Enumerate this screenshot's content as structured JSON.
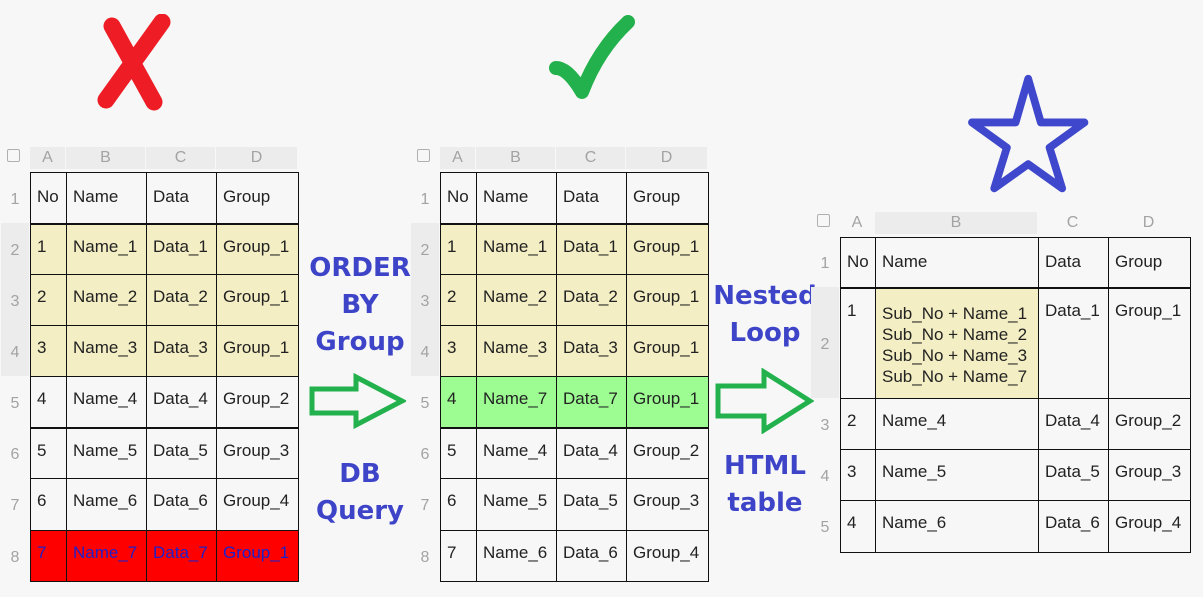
{
  "symbols": {
    "wrong": "cross-mark",
    "right": "check-mark",
    "best": "star-outline",
    "colors": {
      "cross": "#ee1c25",
      "check": "#22b14c",
      "star": "#3f48cc",
      "arrow": "#22b14c",
      "label": "#3f48cc"
    }
  },
  "column_letters": [
    "A",
    "B",
    "C",
    "D"
  ],
  "tables": {
    "wrong": {
      "row_numbers": [
        "1",
        "2",
        "3",
        "4",
        "5",
        "6",
        "7",
        "8"
      ],
      "header": [
        "No",
        "Name",
        "Data",
        "Group"
      ],
      "rows": [
        {
          "cells": [
            "1",
            "Name_1",
            "Data_1",
            "Group_1"
          ],
          "highlight": "yellow"
        },
        {
          "cells": [
            "2",
            "Name_2",
            "Data_2",
            "Group_1"
          ],
          "highlight": "yellow"
        },
        {
          "cells": [
            "3",
            "Name_3",
            "Data_3",
            "Group_1"
          ],
          "highlight": "yellow"
        },
        {
          "cells": [
            "4",
            "Name_4",
            "Data_4",
            "Group_2"
          ],
          "highlight": "none"
        },
        {
          "cells": [
            "5",
            "Name_5",
            "Data_5",
            "Group_3"
          ],
          "highlight": "none"
        },
        {
          "cells": [
            "6",
            "Name_6",
            "Data_6",
            "Group_4"
          ],
          "highlight": "none"
        },
        {
          "cells": [
            "7",
            "Name_7",
            "Data_7",
            "Group_1"
          ],
          "highlight": "red"
        }
      ]
    },
    "sorted": {
      "row_numbers": [
        "1",
        "2",
        "3",
        "4",
        "5",
        "6",
        "7",
        "8"
      ],
      "header": [
        "No",
        "Name",
        "Data",
        "Group"
      ],
      "rows": [
        {
          "cells": [
            "1",
            "Name_1",
            "Data_1",
            "Group_1"
          ],
          "highlight": "yellow"
        },
        {
          "cells": [
            "2",
            "Name_2",
            "Data_2",
            "Group_1"
          ],
          "highlight": "yellow"
        },
        {
          "cells": [
            "3",
            "Name_3",
            "Data_3",
            "Group_1"
          ],
          "highlight": "yellow"
        },
        {
          "cells": [
            "4",
            "Name_7",
            "Data_7",
            "Group_1"
          ],
          "highlight": "green"
        },
        {
          "cells": [
            "5",
            "Name_4",
            "Data_4",
            "Group_2"
          ],
          "highlight": "none"
        },
        {
          "cells": [
            "6",
            "Name_5",
            "Data_5",
            "Group_3"
          ],
          "highlight": "none"
        },
        {
          "cells": [
            "7",
            "Name_6",
            "Data_6",
            "Group_4"
          ],
          "highlight": "none"
        }
      ]
    },
    "nested": {
      "row_numbers": [
        "1",
        "2",
        "3",
        "4",
        "5"
      ],
      "header": [
        "No",
        "Name",
        "Data",
        "Group"
      ],
      "rows": [
        {
          "cells": [
            "1",
            [
              "Sub_No + Name_1",
              "Sub_No + Name_2",
              "Sub_No + Name_3",
              "Sub_No + Name_7"
            ],
            "Data_1",
            "Group_1"
          ],
          "highlight": "yellow-name"
        },
        {
          "cells": [
            "2",
            "Name_4",
            "Data_4",
            "Group_2"
          ],
          "highlight": "none"
        },
        {
          "cells": [
            "3",
            "Name_5",
            "Data_5",
            "Group_3"
          ],
          "highlight": "none"
        },
        {
          "cells": [
            "4",
            "Name_6",
            "Data_6",
            "Group_4"
          ],
          "highlight": "none"
        }
      ]
    }
  },
  "steps": {
    "step1": {
      "top": [
        "ORDER",
        "BY",
        "Group"
      ],
      "bottom": [
        "DB",
        "Query"
      ]
    },
    "step2": {
      "top": [
        "Nested",
        "Loop"
      ],
      "bottom": [
        "HTML",
        "table"
      ]
    }
  }
}
